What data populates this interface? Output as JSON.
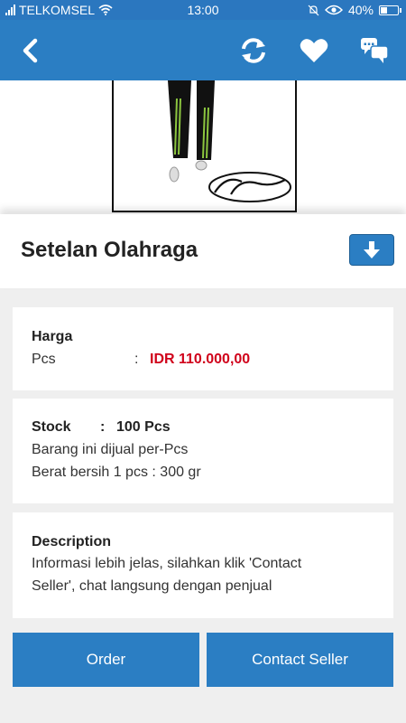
{
  "status_bar": {
    "carrier": "TELKOMSEL",
    "time": "13:00",
    "battery": "40%",
    "battery_level": 0.4
  },
  "app_bar": {
    "icons": [
      "back-arrow-icon",
      "refresh-icon",
      "heart-icon",
      "chat-icon"
    ],
    "color": "#2b7ec3"
  },
  "product": {
    "title": "Setelan Olahraga",
    "download_icon": "download-arrow-icon"
  },
  "price_card": {
    "label": "Harga",
    "unit": "Pcs",
    "separator": ":",
    "price": "IDR 110.000,00",
    "price_color": "#d0021b"
  },
  "stock_card": {
    "label": "Stock",
    "separator": ":",
    "value": "100 Pcs",
    "line1": "Barang ini dijual per-Pcs",
    "line2": "Berat bersih 1 pcs : 300 gr"
  },
  "description_card": {
    "label": "Description",
    "line1": "Informasi lebih jelas, silahkan klik 'Contact",
    "line2": "Seller', chat langsung dengan penjual"
  },
  "actions": {
    "order": "Order",
    "contact": "Contact Seller"
  }
}
